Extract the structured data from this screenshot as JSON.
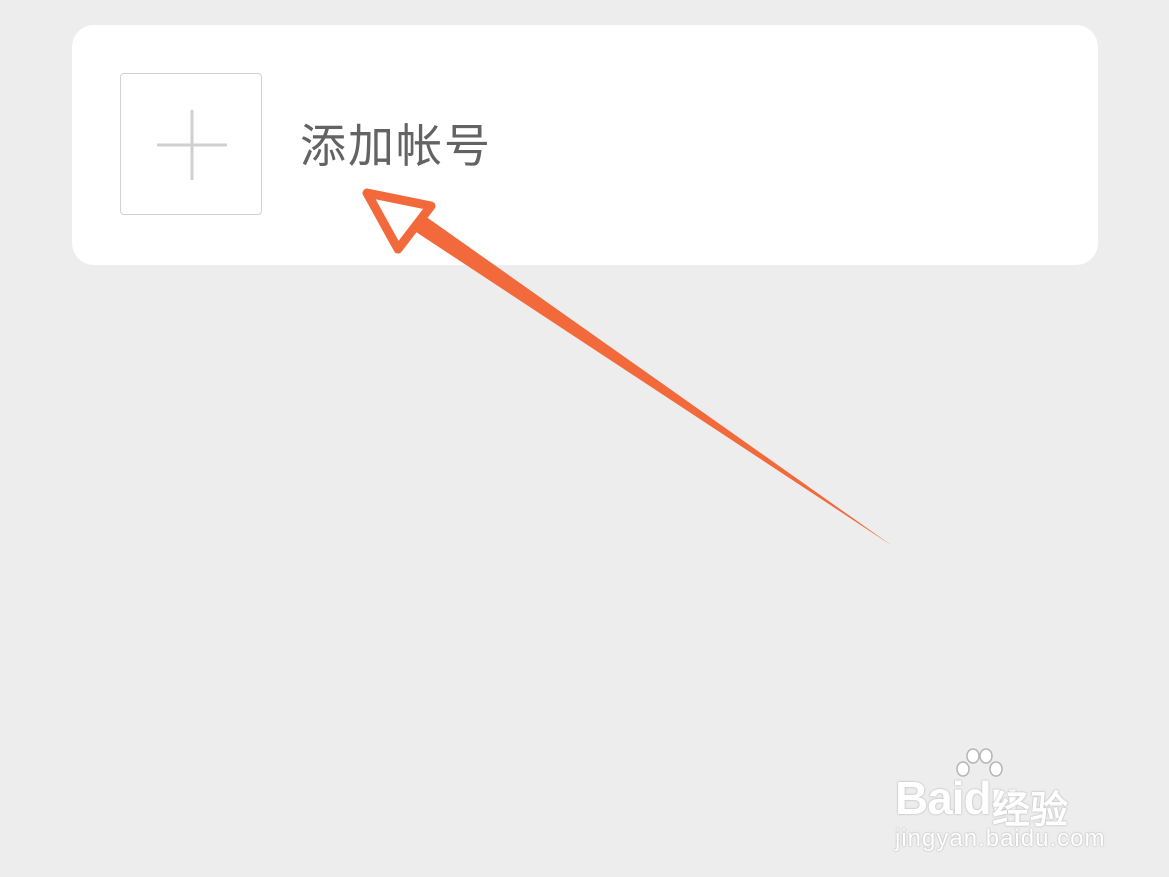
{
  "card": {
    "add_account_label": "添加帐号",
    "plus_icon": "plus-icon"
  },
  "annotation": {
    "arrow_color": "#f26a3b"
  },
  "watermark": {
    "brand_latin": "Bai",
    "brand_du": "du",
    "brand_cn": "经验",
    "url": "jingyan.baidu.com"
  },
  "colors": {
    "background": "#ededed",
    "card": "#ffffff",
    "label": "#636363",
    "plus": "#d2d2d2"
  }
}
